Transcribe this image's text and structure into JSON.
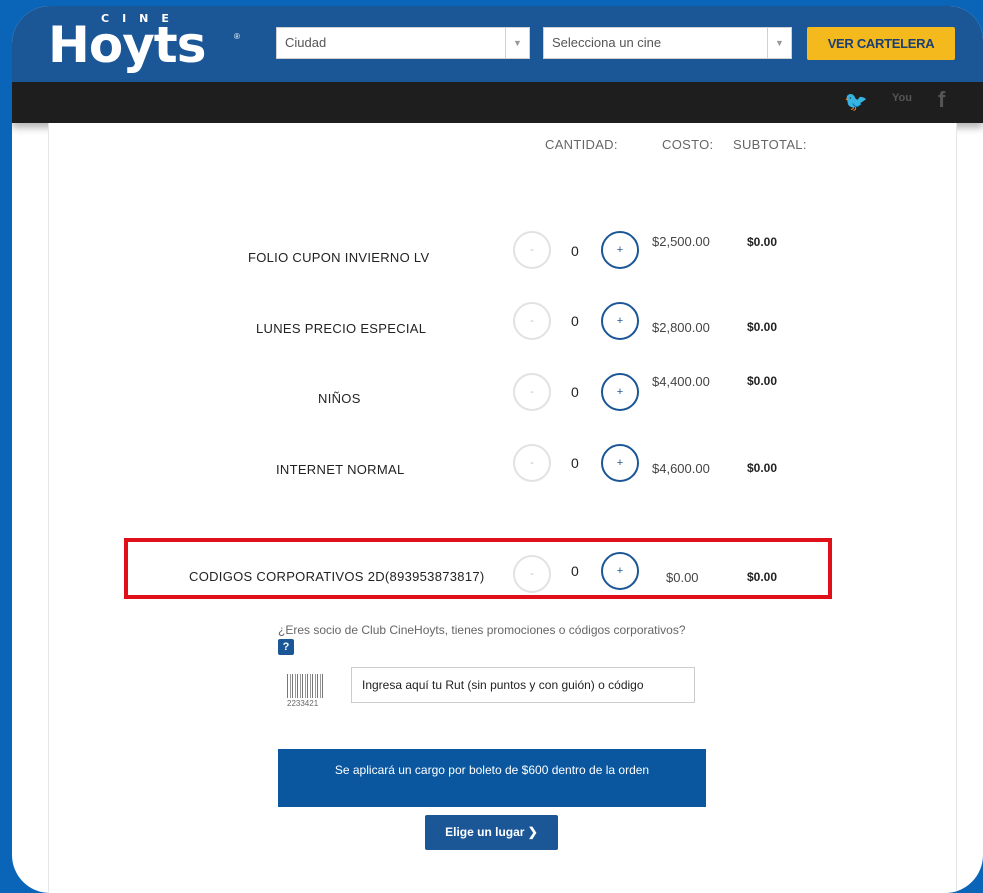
{
  "header": {
    "logo_small": "CINE",
    "logo_brand": "Hoyts",
    "logo_reg": "®",
    "city_select": {
      "value": "Ciudad",
      "arrow": "▼"
    },
    "cinema_select": {
      "value": "Selecciona un cine",
      "arrow": "▼"
    },
    "cartelera_button": "VER CARTELERA"
  },
  "social": {
    "twitter": "🐦",
    "youtube": "You",
    "facebook": "f"
  },
  "table": {
    "headers": {
      "cantidad": "CANTIDAD:",
      "costo": "COSTO:",
      "subtotal": "SUBTOTAL:"
    },
    "rows": [
      {
        "label": "FOLIO CUPON INVIERNO LV",
        "minus": "-",
        "qty": "0",
        "plus": "+",
        "cost": "$2,500.00",
        "subtotal": "$0.00"
      },
      {
        "label": "LUNES PRECIO ESPECIAL",
        "minus": "-",
        "qty": "0",
        "plus": "+",
        "cost": "$2,800.00",
        "subtotal": "$0.00"
      },
      {
        "label": "NIÑOS",
        "minus": "-",
        "qty": "0",
        "plus": "+",
        "cost": "$4,400.00",
        "subtotal": "$0.00"
      },
      {
        "label": "INTERNET NORMAL",
        "minus": "-",
        "qty": "0",
        "plus": "+",
        "cost": "$4,600.00",
        "subtotal": "$0.00"
      },
      {
        "label": "CODIGOS CORPORATIVOS 2D(893953873817)",
        "minus": "-",
        "qty": "0",
        "plus": "+",
        "cost": "$0.00",
        "subtotal": "$0.00"
      }
    ]
  },
  "club": {
    "question": "¿Eres socio de Club CineHoyts, tienes promociones o códigos corporativos?",
    "help": "?",
    "barcode_number": "2233421",
    "input_placeholder": "Ingresa aquí tu Rut (sin puntos y con guión) o código"
  },
  "cargo_notice": "Se aplicará un cargo por boleto de $600 dentro de la orden",
  "elige_button": "Elige un lugar  ❯",
  "colors": {
    "page_bg": "#0a65b8",
    "header": "#1b5797",
    "accent_yellow": "#f3b91d",
    "highlight": "#e0101a"
  }
}
